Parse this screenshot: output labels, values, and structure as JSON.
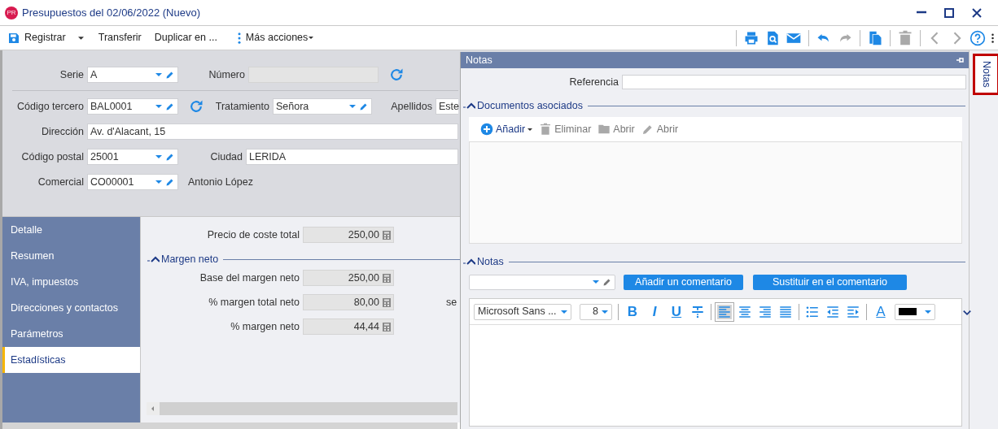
{
  "window": {
    "title": "Presupuestos del 02/06/2022 (Nuevo)",
    "app_badge": "PR"
  },
  "toolbar": {
    "actions": [
      {
        "kind": "save",
        "label": "Registrar"
      },
      {
        "kind": "plain",
        "label": "Transferir"
      },
      {
        "kind": "plain",
        "label": "Duplicar en ..."
      },
      {
        "kind": "more",
        "label": "Más acciones"
      }
    ],
    "icons": [
      {
        "kind": "print",
        "disabled": false,
        "group_start": true
      },
      {
        "kind": "preview",
        "disabled": false,
        "group_start": false
      },
      {
        "kind": "mail",
        "disabled": false,
        "group_start": false
      },
      {
        "kind": "undo",
        "disabled": false,
        "group_start": true
      },
      {
        "kind": "redo",
        "disabled": true,
        "group_start": false
      },
      {
        "kind": "copy",
        "disabled": false,
        "group_start": true
      },
      {
        "kind": "delete",
        "disabled": true,
        "group_start": true
      },
      {
        "kind": "back",
        "disabled": true,
        "group_start": true
      },
      {
        "kind": "forward",
        "disabled": true,
        "group_start": false
      },
      {
        "kind": "help",
        "disabled": false,
        "group_start": false
      },
      {
        "kind": "overflow",
        "disabled": false,
        "group_start": false
      }
    ]
  },
  "header_form": {
    "rows": [
      [
        {
          "kind": "combo",
          "label": "Serie",
          "value": "A"
        },
        {
          "kind": "readonly",
          "label": "Número"
        },
        {
          "kind": "refresh"
        }
      ],
      [
        {
          "kind": "combo",
          "label": "Código tercero",
          "value": "BAL0001"
        },
        {
          "kind": "refresh"
        },
        {
          "kind": "combo",
          "label": "Tratamiento",
          "value": "Señora"
        },
        {
          "kind": "text",
          "label": "Apellidos",
          "value": "Este"
        }
      ],
      [
        {
          "kind": "text",
          "label": "Dirección",
          "value": "Av. d'Alacant, 15"
        }
      ],
      [
        {
          "kind": "combo",
          "label": "Código postal",
          "value": "25001"
        },
        {
          "kind": "text",
          "label": "Ciudad",
          "value": "LERIDA"
        }
      ],
      [
        {
          "kind": "combo",
          "label": "Comercial",
          "value": "CO00001"
        },
        {
          "kind": "note",
          "value": "Antonio López"
        }
      ]
    ]
  },
  "nav": [
    {
      "label": "Detalle",
      "selected": false
    },
    {
      "label": "Resumen",
      "selected": false
    },
    {
      "label": "IVA, impuestos",
      "selected": false
    },
    {
      "label": "Direcciones y contactos",
      "selected": false
    },
    {
      "label": "Parámetros",
      "selected": false
    },
    {
      "label": "Estadísticas",
      "selected": true
    }
  ],
  "statistics": {
    "fields": [
      {
        "label": "Precio de coste total",
        "value": "250,00"
      }
    ],
    "section": {
      "title": "Margen neto",
      "expanded": true,
      "fields": [
        {
          "label": "Base del margen neto",
          "value": "250,00"
        },
        {
          "label": "% margen total neto",
          "value": "80,00",
          "side_text": "se"
        },
        {
          "label": "% margen neto",
          "value": "44,44"
        }
      ]
    }
  },
  "notes_panel": {
    "title": "Notas",
    "reference": {
      "label": "Referencia"
    },
    "documents": {
      "title": "Documentos asociados",
      "expanded": true,
      "actions": [
        {
          "kind": "add",
          "label": "Añadir",
          "disabled": false
        },
        {
          "kind": "delete",
          "label": "Eliminar",
          "disabled": true
        },
        {
          "kind": "folder",
          "label": "Abrir",
          "disabled": true
        },
        {
          "kind": "edit",
          "label": "Abrir",
          "disabled": true
        }
      ]
    },
    "notes": {
      "title": "Notas",
      "expanded": true,
      "buttons": [
        "Añadir un comentario",
        "Sustituir en el comentario"
      ],
      "editor": {
        "font": "Microsoft Sans ...",
        "size": "8",
        "color": "#000000",
        "tools": [
          {
            "kind": "bold",
            "label": "B",
            "selected": false,
            "group_start": true
          },
          {
            "kind": "italic",
            "label": "I",
            "selected": false,
            "group_start": false
          },
          {
            "kind": "underline",
            "label": "U",
            "selected": false,
            "group_start": false
          },
          {
            "kind": "strike",
            "selected": false,
            "group_start": false
          },
          {
            "kind": "align-left",
            "selected": true,
            "group_start": true
          },
          {
            "kind": "align-center",
            "selected": false,
            "group_start": false
          },
          {
            "kind": "align-right",
            "selected": false,
            "group_start": false
          },
          {
            "kind": "justify",
            "selected": false,
            "group_start": false
          },
          {
            "kind": "bullets",
            "selected": false,
            "group_start": true
          },
          {
            "kind": "outdent",
            "selected": false,
            "group_start": false
          },
          {
            "kind": "indent",
            "selected": false,
            "group_start": false
          },
          {
            "kind": "font-color",
            "label": "A",
            "selected": false,
            "group_start": true
          }
        ]
      }
    }
  },
  "side_tabs": [
    {
      "label": "Notas",
      "selected": true,
      "highlighted": true
    }
  ]
}
